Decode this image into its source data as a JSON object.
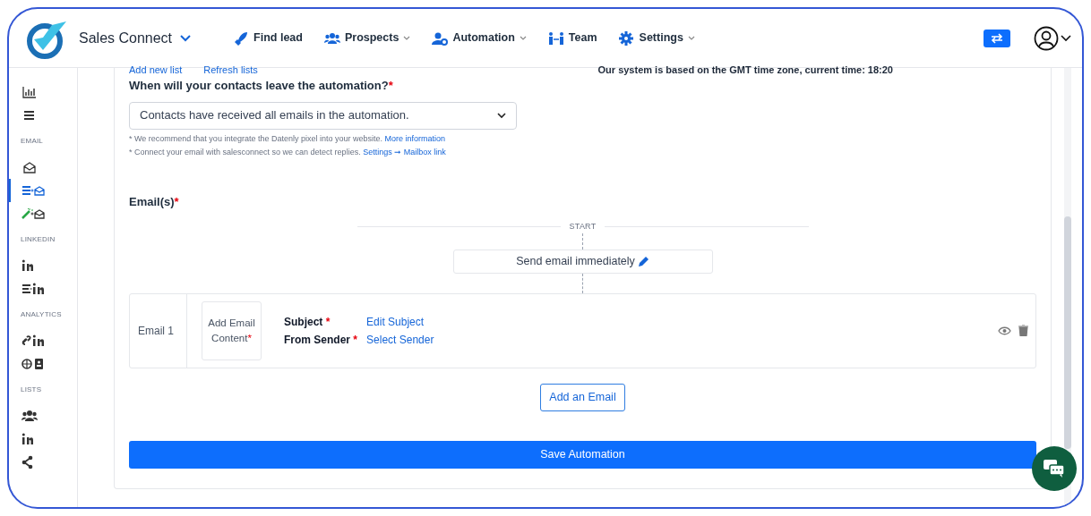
{
  "header": {
    "brand": "Sales Connect",
    "nav": [
      {
        "label": "Find lead",
        "dropdown": false
      },
      {
        "label": "Prospects",
        "dropdown": true
      },
      {
        "label": "Automation",
        "dropdown": true
      },
      {
        "label": "Team",
        "dropdown": false
      },
      {
        "label": "Settings",
        "dropdown": true
      }
    ]
  },
  "sidebar": [
    {
      "kind": "link",
      "selected": false
    },
    {
      "kind": "link",
      "selected": false
    },
    {
      "kind": "section",
      "label": "EMAIL"
    },
    {
      "kind": "link",
      "selected": false
    },
    {
      "kind": "link",
      "selected": true
    },
    {
      "kind": "link",
      "selected": false
    },
    {
      "kind": "section",
      "label": "LINKEDIN"
    },
    {
      "kind": "link",
      "selected": false
    },
    {
      "kind": "link",
      "selected": false
    },
    {
      "kind": "section",
      "label": "ANALYTICS"
    },
    {
      "kind": "link",
      "selected": false
    },
    {
      "kind": "link",
      "selected": false
    },
    {
      "kind": "section",
      "label": "LISTS"
    },
    {
      "kind": "link",
      "selected": false
    },
    {
      "kind": "link",
      "selected": false
    },
    {
      "kind": "link",
      "selected": false
    }
  ],
  "top_links": [
    "Add new list",
    "Refresh lists"
  ],
  "timezone_note": "Our system is based on the GMT time zone, current time: 18:20",
  "exit_question": {
    "label": "When will your contacts leave the automation?",
    "required_mark": "*",
    "value": "Contacts have received all emails in the automation."
  },
  "notes": [
    {
      "text": "* We recommend that you integrate the Datenly pixel into your website.",
      "link": "More information"
    },
    {
      "text": "* Connect your email with salesconnect so we can detect replies.",
      "link": "Settings ➞ Mailbox link"
    }
  ],
  "emails_label": "Email(s)",
  "emails_required_mark": "*",
  "flow": {
    "start": "START",
    "delay": "Send email immediately"
  },
  "emails": [
    {
      "name": "Email 1",
      "content": "Add Email Content",
      "content_required_mark": "*",
      "subject_label": "Subject",
      "subject_required_mark": "*",
      "subject": "Edit Subject",
      "sender_label": "From Sender",
      "sender_required_mark": "*",
      "sender": "Select Sender"
    }
  ],
  "add_button": "Add an Email",
  "save_button": "Save Automation"
}
